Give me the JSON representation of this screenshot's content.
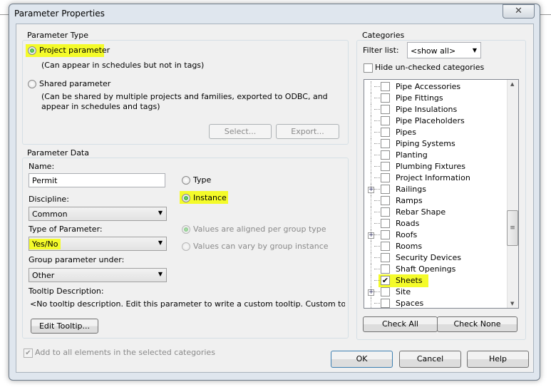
{
  "window": {
    "title": "Parameter Properties",
    "close_icon": "close-x"
  },
  "parameter_type": {
    "label": "Parameter Type",
    "project_label": "Project parameter",
    "project_desc": "(Can appear in schedules but not in tags)",
    "shared_label": "Shared parameter",
    "shared_desc1": "(Can be shared by multiple projects and families, exported to ODBC, and",
    "shared_desc2": "appear in schedules and tags)",
    "select_btn": "Select...",
    "export_btn": "Export...",
    "selected": "project"
  },
  "parameter_data": {
    "label": "Parameter Data",
    "name_label": "Name:",
    "name_value": "Permit",
    "type_label": "Type",
    "instance_label": "Instance",
    "selected": "instance",
    "discipline_label": "Discipline:",
    "discipline_value": "Common",
    "type_of_param_label": "Type of Parameter:",
    "type_of_param_value": "Yes/No",
    "aligned_label": "Values are aligned per group type",
    "vary_label": "Values can vary by group instance",
    "group_label": "Group parameter under:",
    "group_value": "Other",
    "tooltip_label": "Tooltip Description:",
    "tooltip_value": "<No tooltip description. Edit this parameter to write a custom tooltip. Custom tooltips hav...",
    "edit_tooltip_btn": "Edit Tooltip..."
  },
  "add_all": {
    "label": "Add to all elements in the selected categories",
    "checked": true,
    "disabled": true
  },
  "categories": {
    "label": "Categories",
    "filter_label": "Filter list:",
    "filter_value": "<show all>",
    "hide_label": "Hide un-checked categories",
    "check_all": "Check All",
    "check_none": "Check None",
    "items": [
      {
        "label": "Pipe Accessories",
        "checked": false,
        "expandable": false
      },
      {
        "label": "Pipe Fittings",
        "checked": false,
        "expandable": false
      },
      {
        "label": "Pipe Insulations",
        "checked": false,
        "expandable": false
      },
      {
        "label": "Pipe Placeholders",
        "checked": false,
        "expandable": false
      },
      {
        "label": "Pipes",
        "checked": false,
        "expandable": false
      },
      {
        "label": "Piping Systems",
        "checked": false,
        "expandable": false
      },
      {
        "label": "Planting",
        "checked": false,
        "expandable": false
      },
      {
        "label": "Plumbing Fixtures",
        "checked": false,
        "expandable": false
      },
      {
        "label": "Project Information",
        "checked": false,
        "expandable": false
      },
      {
        "label": "Railings",
        "checked": false,
        "expandable": true
      },
      {
        "label": "Ramps",
        "checked": false,
        "expandable": false
      },
      {
        "label": "Rebar Shape",
        "checked": false,
        "expandable": false
      },
      {
        "label": "Roads",
        "checked": false,
        "expandable": false
      },
      {
        "label": "Roofs",
        "checked": false,
        "expandable": true
      },
      {
        "label": "Rooms",
        "checked": false,
        "expandable": false
      },
      {
        "label": "Security Devices",
        "checked": false,
        "expandable": false
      },
      {
        "label": "Shaft Openings",
        "checked": false,
        "expandable": false
      },
      {
        "label": "Sheets",
        "checked": true,
        "expandable": false
      },
      {
        "label": "Site",
        "checked": false,
        "expandable": true
      },
      {
        "label": "Spaces",
        "checked": false,
        "expandable": false
      }
    ]
  },
  "footer": {
    "ok": "OK",
    "cancel": "Cancel",
    "help": "Help"
  },
  "colors": {
    "highlight": "#f4fb2a"
  }
}
